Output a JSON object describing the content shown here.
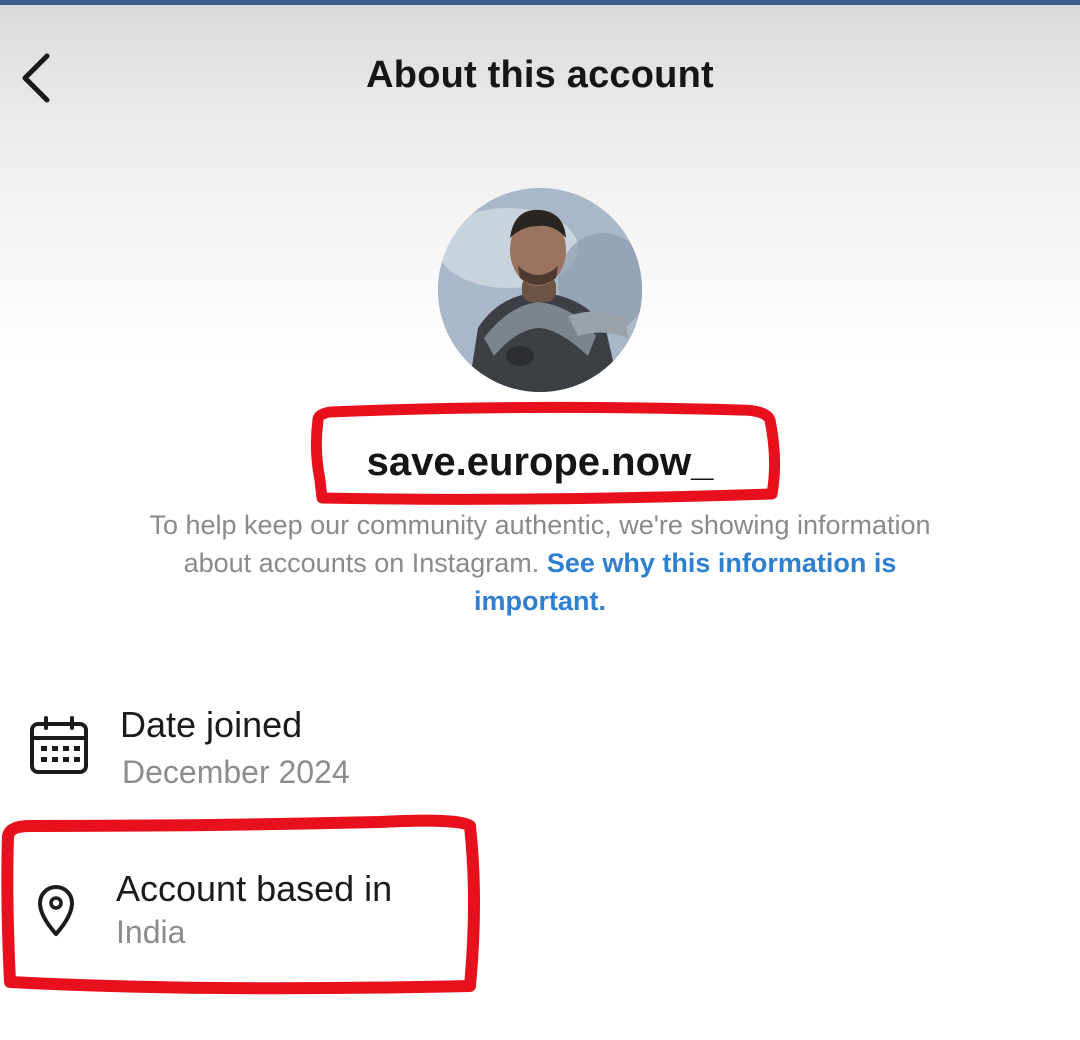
{
  "header": {
    "title": "About this account",
    "back_icon": "chevron-left-icon"
  },
  "profile": {
    "avatar": "profile-photo",
    "username": "save.europe.now_"
  },
  "notice": {
    "text": "To help keep our community authentic, we're showing information about accounts on Instagram.",
    "link_text": "See why this information is important."
  },
  "details": [
    {
      "icon": "calendar-icon",
      "label": "Date joined",
      "value": "December 2024"
    },
    {
      "icon": "location-pin-icon",
      "label": "Account based in",
      "value": "India"
    }
  ],
  "colors": {
    "annotation": "#e8101c",
    "link": "#2e7fd0",
    "top_strip": "#3e5b8c"
  }
}
